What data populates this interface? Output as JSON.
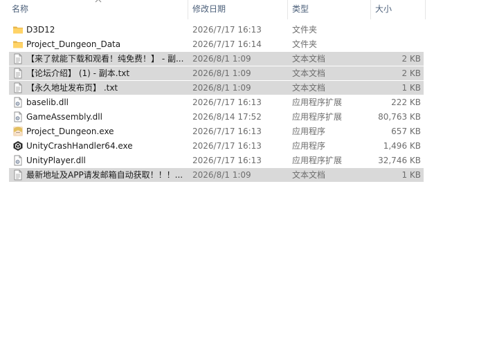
{
  "header": {
    "name": "名称",
    "date": "修改日期",
    "type": "类型",
    "size": "大小"
  },
  "files": [
    {
      "name": "D3D12",
      "date": "2026/7/17 16:13",
      "type": "文件夹",
      "size": "",
      "icon": "folder-icon",
      "selected": false
    },
    {
      "name": "Project_Dungeon_Data",
      "date": "2026/7/17 16:14",
      "type": "文件夹",
      "size": "",
      "icon": "folder-icon",
      "selected": false
    },
    {
      "name": "【来了就能下载和观看！纯免费！】 - 副...",
      "date": "2026/8/1 1:09",
      "type": "文本文档",
      "size": "2 KB",
      "icon": "text-file-icon",
      "selected": true
    },
    {
      "name": "【论坛介绍】 (1) - 副本.txt",
      "date": "2026/8/1 1:09",
      "type": "文本文档",
      "size": "2 KB",
      "icon": "text-file-icon",
      "selected": true
    },
    {
      "name": "【永久地址发布页】 .txt",
      "date": "2026/8/1 1:09",
      "type": "文本文档",
      "size": "1 KB",
      "icon": "text-file-icon",
      "selected": true
    },
    {
      "name": "baselib.dll",
      "date": "2026/7/17 16:13",
      "type": "应用程序扩展",
      "size": "222 KB",
      "icon": "dll-file-icon",
      "selected": false
    },
    {
      "name": "GameAssembly.dll",
      "date": "2026/8/14 17:52",
      "type": "应用程序扩展",
      "size": "80,763 KB",
      "icon": "dll-file-icon",
      "selected": false
    },
    {
      "name": "Project_Dungeon.exe",
      "date": "2026/7/17 16:13",
      "type": "应用程序",
      "size": "657 KB",
      "icon": "game-app-icon",
      "selected": false
    },
    {
      "name": "UnityCrashHandler64.exe",
      "date": "2026/7/17 16:13",
      "type": "应用程序",
      "size": "1,496 KB",
      "icon": "unity-app-icon",
      "selected": false
    },
    {
      "name": "UnityPlayer.dll",
      "date": "2026/7/17 16:13",
      "type": "应用程序扩展",
      "size": "32,746 KB",
      "icon": "dll-file-icon",
      "selected": false
    },
    {
      "name": "最新地址及APP请发邮箱自动获取！！！...",
      "date": "2026/8/1 1:09",
      "type": "文本文档",
      "size": "1 KB",
      "icon": "text-file-icon",
      "selected": true
    }
  ]
}
